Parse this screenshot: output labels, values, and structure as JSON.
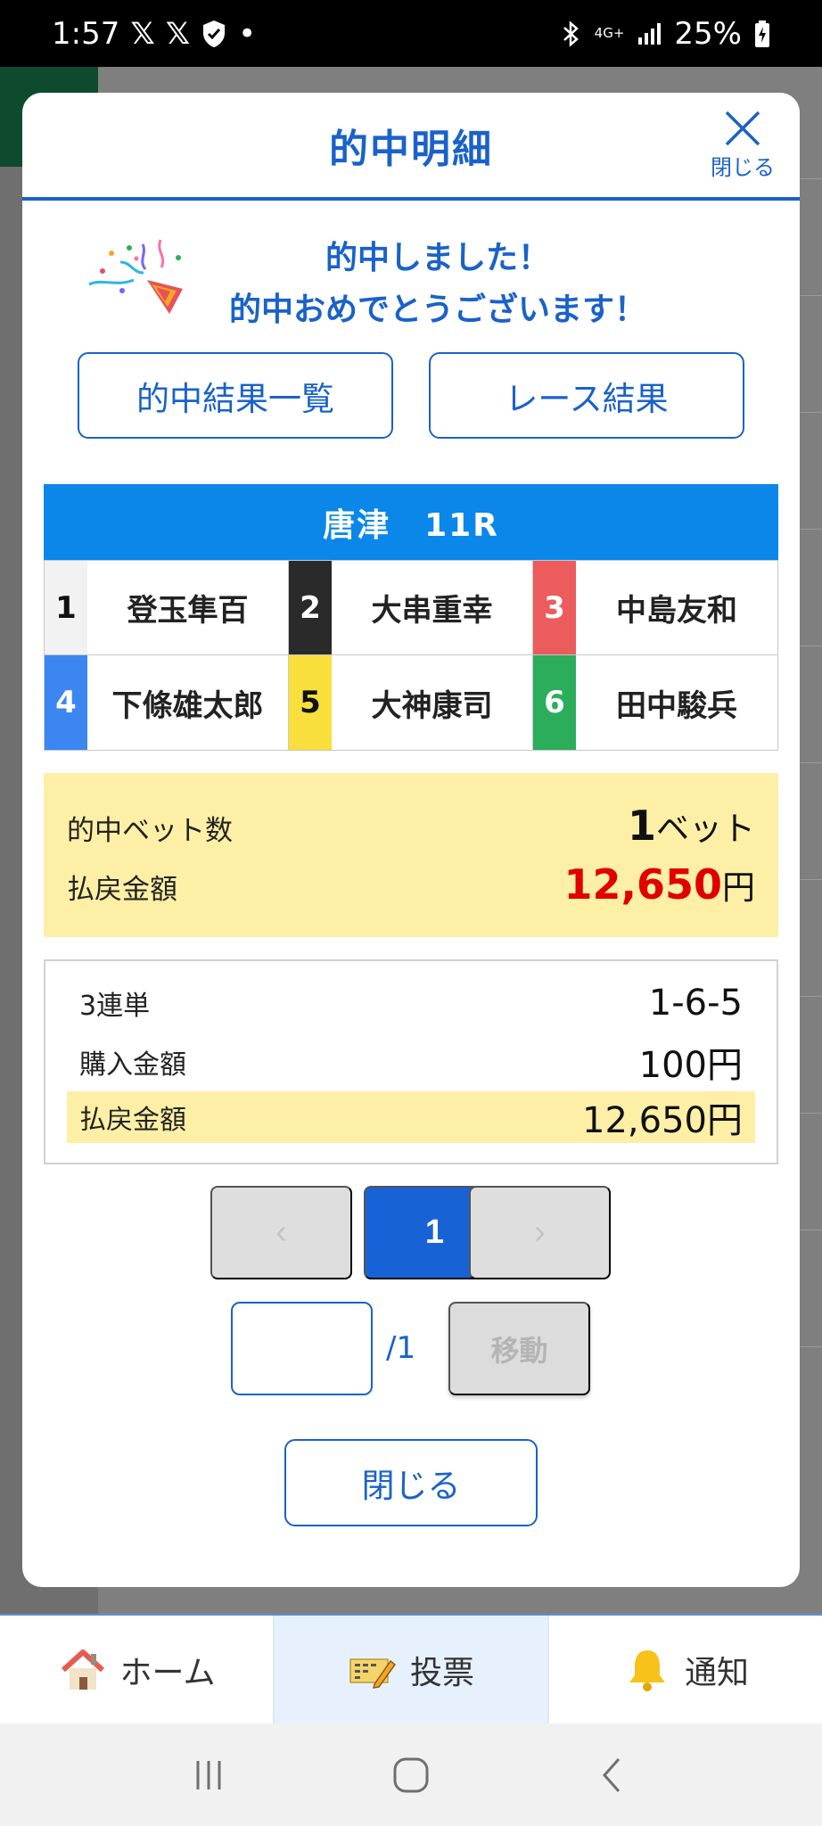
{
  "status_bar": {
    "time": "1:57",
    "x1": "𝕏",
    "x2": "𝕏",
    "dot": "•",
    "network": "4G+",
    "battery": "25%"
  },
  "modal": {
    "title": "的中明細",
    "close_label": "閉じる",
    "congrats_line1": "的中しました！",
    "congrats_line2": "的中おめでとうございます！",
    "btn_results_list": "的中結果一覧",
    "btn_race_result": "レース結果",
    "race_title": "唐津　11R",
    "racers": [
      {
        "num": "1",
        "name": "登玉隼百",
        "bg": "#f2f2f2",
        "fg": "#111111"
      },
      {
        "num": "2",
        "name": "大串重幸",
        "bg": "#2a2a2a",
        "fg": "#ffffff"
      },
      {
        "num": "3",
        "name": "中島友和",
        "bg": "#ec5c5c",
        "fg": "#ffffff"
      },
      {
        "num": "4",
        "name": "下條雄太郎",
        "bg": "#3b86f0",
        "fg": "#ffffff"
      },
      {
        "num": "5",
        "name": "大神康司",
        "bg": "#f9df3b",
        "fg": "#111111"
      },
      {
        "num": "6",
        "name": "田中駿兵",
        "bg": "#2bad5c",
        "fg": "#ffffff"
      }
    ],
    "summary": {
      "bets_label": "的中ベット数",
      "bets_count": "1",
      "bets_unit": "ベット",
      "payout_label": "払戻金額",
      "payout_amount": "12,650",
      "payout_unit": "円"
    },
    "detail": {
      "type_label": "3連単",
      "combination": "1-6-5",
      "purchase_label": "購入金額",
      "purchase_amount": "100円",
      "payout_label": "払戻金額",
      "payout_amount": "12,650円"
    },
    "pagination": {
      "prev": "‹",
      "current": "1",
      "next": "›",
      "total": "/1",
      "move_label": "移動"
    },
    "close_button": "閉じる"
  },
  "bottom_nav": {
    "home": "ホーム",
    "vote": "投票",
    "notify": "通知"
  }
}
